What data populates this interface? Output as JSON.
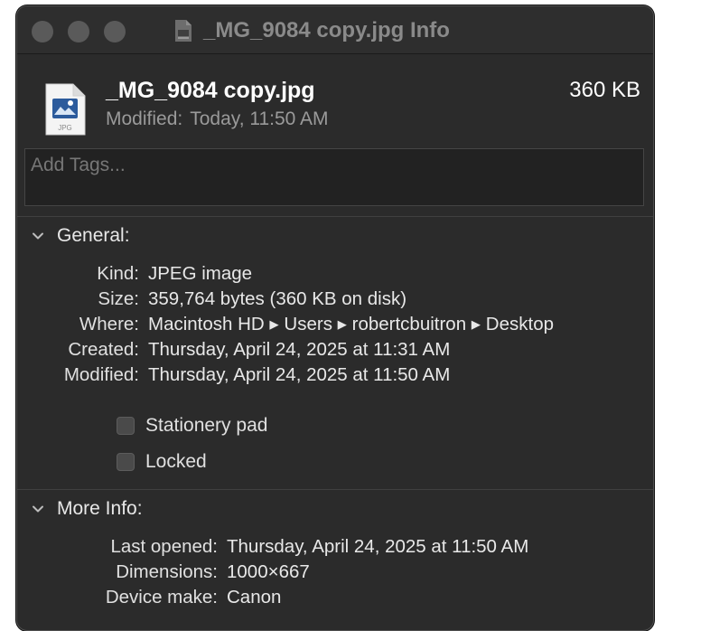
{
  "window": {
    "title": "_MG_9084 copy.jpg Info"
  },
  "file": {
    "name": "_MG_9084 copy.jpg",
    "size": "360 KB",
    "modified_label": "Modified:",
    "modified_value": "Today, 11:50 AM",
    "icon": "jpeg-file-icon",
    "icon_badge": "JPG"
  },
  "tags": {
    "placeholder": "Add Tags..."
  },
  "general": {
    "title": "General:",
    "rows": [
      {
        "label": "Kind:",
        "value": "JPEG image"
      },
      {
        "label": "Size:",
        "value": "359,764 bytes (360 KB on disk)"
      },
      {
        "label": "Where:",
        "value": "Macintosh HD ▸ Users ▸ robertcbuitron ▸ Desktop"
      },
      {
        "label": "Created:",
        "value": "Thursday, April 24, 2025 at 11:31 AM"
      },
      {
        "label": "Modified:",
        "value": "Thursday, April 24, 2025 at 11:50 AM"
      }
    ],
    "checkboxes": [
      {
        "label": "Stationery pad",
        "checked": false
      },
      {
        "label": "Locked",
        "checked": false
      }
    ]
  },
  "more_info": {
    "title": "More Info:",
    "rows": [
      {
        "label": "Last opened:",
        "value": "Thursday, April 24, 2025 at 11:50 AM"
      },
      {
        "label": "Dimensions:",
        "value": "1000×667"
      },
      {
        "label": "Device make:",
        "value": "Canon"
      }
    ]
  },
  "colors": {
    "window_bg": "#2b2b2b",
    "traffic_inactive": "#5a5a5a",
    "text_primary": "#ffffff",
    "text_secondary": "#9a9a9a"
  }
}
